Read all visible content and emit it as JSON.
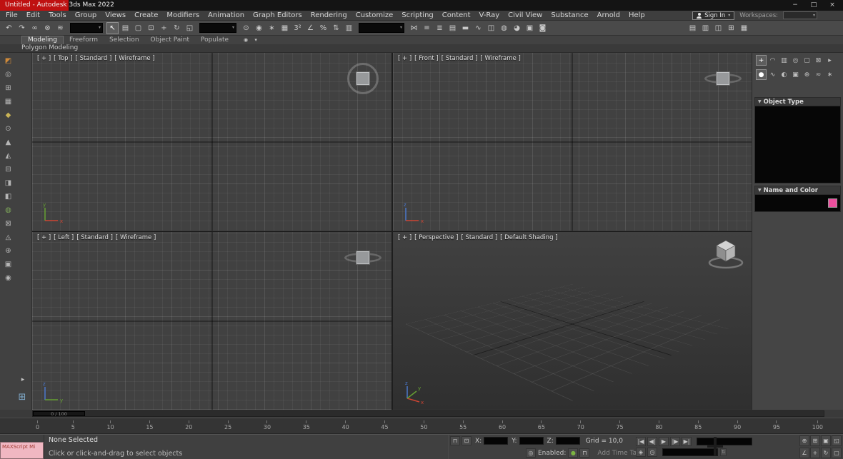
{
  "colors": {
    "titlebar_accent": "#bf1111",
    "active_viewport_border": "#d9d9d9",
    "name_color_swatch": "#ec4f9e",
    "maxscript_pink": "#f0b7c2"
  },
  "titlebar": {
    "title": "Untitled - Autodesk 3ds Max 2022",
    "minimize": "−",
    "maximize": "□",
    "close": "×"
  },
  "menubar": {
    "items": [
      {
        "name": "menu-file",
        "label": "File"
      },
      {
        "name": "menu-edit",
        "label": "Edit"
      },
      {
        "name": "menu-tools",
        "label": "Tools"
      },
      {
        "name": "menu-group",
        "label": "Group"
      },
      {
        "name": "menu-views",
        "label": "Views"
      },
      {
        "name": "menu-create",
        "label": "Create"
      },
      {
        "name": "menu-modifiers",
        "label": "Modifiers"
      },
      {
        "name": "menu-animation",
        "label": "Animation"
      },
      {
        "name": "menu-graph-editors",
        "label": "Graph Editors"
      },
      {
        "name": "menu-rendering",
        "label": "Rendering"
      },
      {
        "name": "menu-customize",
        "label": "Customize"
      },
      {
        "name": "menu-scripting",
        "label": "Scripting"
      },
      {
        "name": "menu-content",
        "label": "Content"
      },
      {
        "name": "menu-vray",
        "label": "V-Ray"
      },
      {
        "name": "menu-civil-view",
        "label": "Civil View"
      },
      {
        "name": "menu-substance",
        "label": "Substance"
      },
      {
        "name": "menu-arnold",
        "label": "Arnold"
      },
      {
        "name": "menu-help",
        "label": "Help"
      }
    ],
    "sign_in_label": "Sign In",
    "workspaces_label": "Workspaces:"
  },
  "toolbar": {
    "group_a": [
      {
        "name": "undo-icon",
        "glyph": "↶"
      },
      {
        "name": "redo-icon",
        "glyph": "↷"
      },
      {
        "name": "select-and-link-icon",
        "glyph": "∞"
      },
      {
        "name": "unlink-selection-icon",
        "glyph": "⊗"
      },
      {
        "name": "bind-to-space-warp-icon",
        "glyph": "≋"
      }
    ],
    "group_b": [
      {
        "name": "select-object-icon",
        "glyph": "↖",
        "active": true
      },
      {
        "name": "select-by-name-icon",
        "glyph": "▤"
      },
      {
        "name": "rectangular-selection-region-icon",
        "glyph": "▢"
      },
      {
        "name": "window-crossing-toggle-icon",
        "glyph": "⊡"
      },
      {
        "name": "select-and-move-icon",
        "glyph": "+"
      },
      {
        "name": "select-and-rotate-icon",
        "glyph": "↻"
      },
      {
        "name": "select-and-scale-icon",
        "glyph": "◱"
      }
    ],
    "group_c": [
      {
        "name": "use-pivot-center-icon",
        "glyph": "⊙"
      },
      {
        "name": "select-and-place-icon",
        "glyph": "◉"
      },
      {
        "name": "select-and-manipulate-icon",
        "glyph": "∗"
      },
      {
        "name": "keyboard-shortcut-override-icon",
        "glyph": "▦"
      },
      {
        "name": "snap-toggle-3d-icon",
        "glyph": "3²"
      },
      {
        "name": "angle-snap-icon",
        "glyph": "∠"
      },
      {
        "name": "percent-snap-icon",
        "glyph": "%"
      },
      {
        "name": "spinner-snap-icon",
        "glyph": "⇅"
      },
      {
        "name": "edit-named-selection-sets-icon",
        "glyph": "▥"
      }
    ],
    "group_d": [
      {
        "name": "mirror-icon",
        "glyph": "⋈"
      },
      {
        "name": "align-icon",
        "glyph": "≡"
      },
      {
        "name": "toggle-scene-explorer-icon",
        "glyph": "≣"
      },
      {
        "name": "toggle-layer-explorer-icon",
        "glyph": "▤"
      },
      {
        "name": "toggle-ribbon-icon",
        "glyph": "▬"
      },
      {
        "name": "curve-editor-icon",
        "glyph": "∿"
      },
      {
        "name": "schematic-view-icon",
        "glyph": "◫"
      },
      {
        "name": "material-editor-icon",
        "glyph": "◍"
      },
      {
        "name": "render-setup-icon",
        "glyph": "◕"
      },
      {
        "name": "rendered-frame-window-icon",
        "glyph": "▣"
      },
      {
        "name": "render-production-icon",
        "glyph": "◙"
      }
    ],
    "right_group": [
      {
        "name": "docked-scene-explorer-icon",
        "glyph": "▤"
      },
      {
        "name": "docked-layer-explorer-icon",
        "glyph": "▥"
      },
      {
        "name": "docked-view-icon",
        "glyph": "◫"
      },
      {
        "name": "docked-grid-icon",
        "glyph": "⊞"
      },
      {
        "name": "docked-panel-icon",
        "glyph": "▦"
      }
    ]
  },
  "ribbon": {
    "tabs": [
      {
        "name": "tab-modeling",
        "label": "Modeling",
        "active": true
      },
      {
        "name": "tab-freeform",
        "label": "Freeform"
      },
      {
        "name": "tab-selection",
        "label": "Selection"
      },
      {
        "name": "tab-object-paint",
        "label": "Object Paint"
      },
      {
        "name": "tab-populate",
        "label": "Populate"
      }
    ],
    "extra": [
      {
        "name": "ribbon-config-icon",
        "glyph": "◉"
      },
      {
        "name": "ribbon-minimize-arrow-icon",
        "glyph": "▾"
      }
    ],
    "panel_label": "Polygon Modeling"
  },
  "left_toolbar": {
    "icons": [
      {
        "name": "left-tool-01-icon",
        "glyph": "◩",
        "color": "#cf8a3a"
      },
      {
        "name": "left-tool-02-icon",
        "glyph": "◎"
      },
      {
        "name": "left-tool-03-icon",
        "glyph": "⊞"
      },
      {
        "name": "left-tool-04-icon",
        "glyph": "▦"
      },
      {
        "name": "left-tool-05-icon",
        "glyph": "◆",
        "color": "#c9b356"
      },
      {
        "name": "left-tool-06-icon",
        "glyph": "⊙"
      },
      {
        "name": "left-tool-07-icon",
        "glyph": "▲"
      },
      {
        "name": "left-tool-08-icon",
        "glyph": "◭"
      },
      {
        "name": "left-tool-09-icon",
        "glyph": "⊟"
      },
      {
        "name": "left-tool-10-icon",
        "glyph": "◨"
      },
      {
        "name": "left-tool-11-icon",
        "glyph": "◧"
      },
      {
        "name": "left-tool-12-icon",
        "glyph": "◍",
        "color": "#7da65a"
      },
      {
        "name": "left-tool-13-icon",
        "glyph": "⊠"
      },
      {
        "name": "left-tool-14-icon",
        "glyph": "◬"
      },
      {
        "name": "left-tool-15-icon",
        "glyph": "⊕"
      },
      {
        "name": "left-tool-16-icon",
        "glyph": "▣"
      },
      {
        "name": "left-tool-eye-icon",
        "glyph": "◉"
      }
    ],
    "expand_glyph": "▸",
    "layout_tabs_glyph": "⊞"
  },
  "viewports": [
    {
      "general": "[ + ]",
      "pov": "[ Top ]",
      "style": "[ Standard ]",
      "shading": "[ Wireframe ]"
    },
    {
      "general": "[ + ]",
      "pov": "[ Front ]",
      "style": "[ Standard ]",
      "shading": "[ Wireframe ]"
    },
    {
      "general": "[ + ]",
      "pov": "[ Left ]",
      "style": "[ Standard ]",
      "shading": "[ Wireframe ]"
    },
    {
      "general": "[ + ]",
      "pov": "[ Perspective ]",
      "style": "[ Standard ]",
      "shading": "[ Default Shading ]"
    }
  ],
  "command_panel": {
    "tabs": [
      {
        "name": "create-tab-icon",
        "glyph": "+",
        "active": true
      },
      {
        "name": "modify-tab-icon",
        "glyph": "◠"
      },
      {
        "name": "hierarchy-tab-icon",
        "glyph": "▥"
      },
      {
        "name": "motion-tab-icon",
        "glyph": "◎"
      },
      {
        "name": "display-tab-icon",
        "glyph": "▢"
      },
      {
        "name": "utilities-tab-icon",
        "glyph": "⊠"
      },
      {
        "name": "panel-options-arrow-icon",
        "glyph": "▸"
      }
    ],
    "categories": [
      {
        "name": "geometry-category-icon",
        "glyph": "●",
        "active": true
      },
      {
        "name": "shapes-category-icon",
        "glyph": "∿"
      },
      {
        "name": "lights-category-icon",
        "glyph": "◐"
      },
      {
        "name": "cameras-category-icon",
        "glyph": "▣"
      },
      {
        "name": "helpers-category-icon",
        "glyph": "⊕"
      },
      {
        "name": "space-warps-category-icon",
        "glyph": "≈"
      },
      {
        "name": "systems-category-icon",
        "glyph": "∗"
      }
    ],
    "rollouts": {
      "object_type": "Object Type",
      "name_and_color": "Name and Color"
    }
  },
  "timeline": {
    "slider_label": "0 / 100",
    "ticks": [
      "0",
      "5",
      "10",
      "15",
      "20",
      "25",
      "30",
      "35",
      "40",
      "45",
      "50",
      "55",
      "60",
      "65",
      "70",
      "75",
      "80",
      "85",
      "90",
      "95",
      "100"
    ]
  },
  "statusbar": {
    "maxscript_label": "MAXScript Mi",
    "selection_status": "None Selected",
    "prompt": "Click or click-and-drag to select objects",
    "x_label": "X:",
    "y_label": "Y:",
    "z_label": "Z:",
    "grid_label": "Grid = 10,0",
    "enabled_label": "Enabled:",
    "add_time_tag_label": "Add Time Tag",
    "mid_row1_icons": [
      {
        "name": "selection-lock-toggle-icon",
        "glyph": "⊓"
      },
      {
        "name": "transform-gizmo-toggle-icon",
        "glyph": "⊡"
      }
    ],
    "enabled_prefix_icons": [
      {
        "name": "maxscript-listener-log-icon",
        "glyph": "◎"
      }
    ],
    "enabled_suffix_icons": [
      {
        "name": "progressive-display-on-icon",
        "glyph": "●",
        "color": "#7cb342"
      },
      {
        "name": "time-tag-lock-icon",
        "glyph": "⊓"
      }
    ],
    "playback_row1": [
      {
        "name": "go-to-start-icon",
        "glyph": "|◀"
      },
      {
        "name": "previous-frame-icon",
        "glyph": "◀|"
      },
      {
        "name": "play-animation-icon",
        "glyph": "▶"
      },
      {
        "name": "next-frame-icon",
        "glyph": "|▶"
      },
      {
        "name": "go-to-end-icon",
        "glyph": "▶|"
      }
    ],
    "playback_row2": [
      {
        "name": "key-mode-toggle-icon",
        "glyph": "◈"
      },
      {
        "name": "time-configuration-icon",
        "glyph": "◷"
      }
    ],
    "nav_buttons": [
      {
        "name": "zoom-icon",
        "glyph": "⊕"
      },
      {
        "name": "zoom-all-icon",
        "glyph": "⊞"
      },
      {
        "name": "zoom-extents-icon",
        "glyph": "▣"
      },
      {
        "name": "zoom-extents-all-icon",
        "glyph": "◱"
      },
      {
        "name": "field-of-view-icon",
        "glyph": "∠"
      },
      {
        "name": "pan-view-icon",
        "glyph": "+"
      },
      {
        "name": "orbit-icon",
        "glyph": "↻"
      },
      {
        "name": "maximize-viewport-toggle-icon",
        "glyph": "▢"
      }
    ]
  }
}
